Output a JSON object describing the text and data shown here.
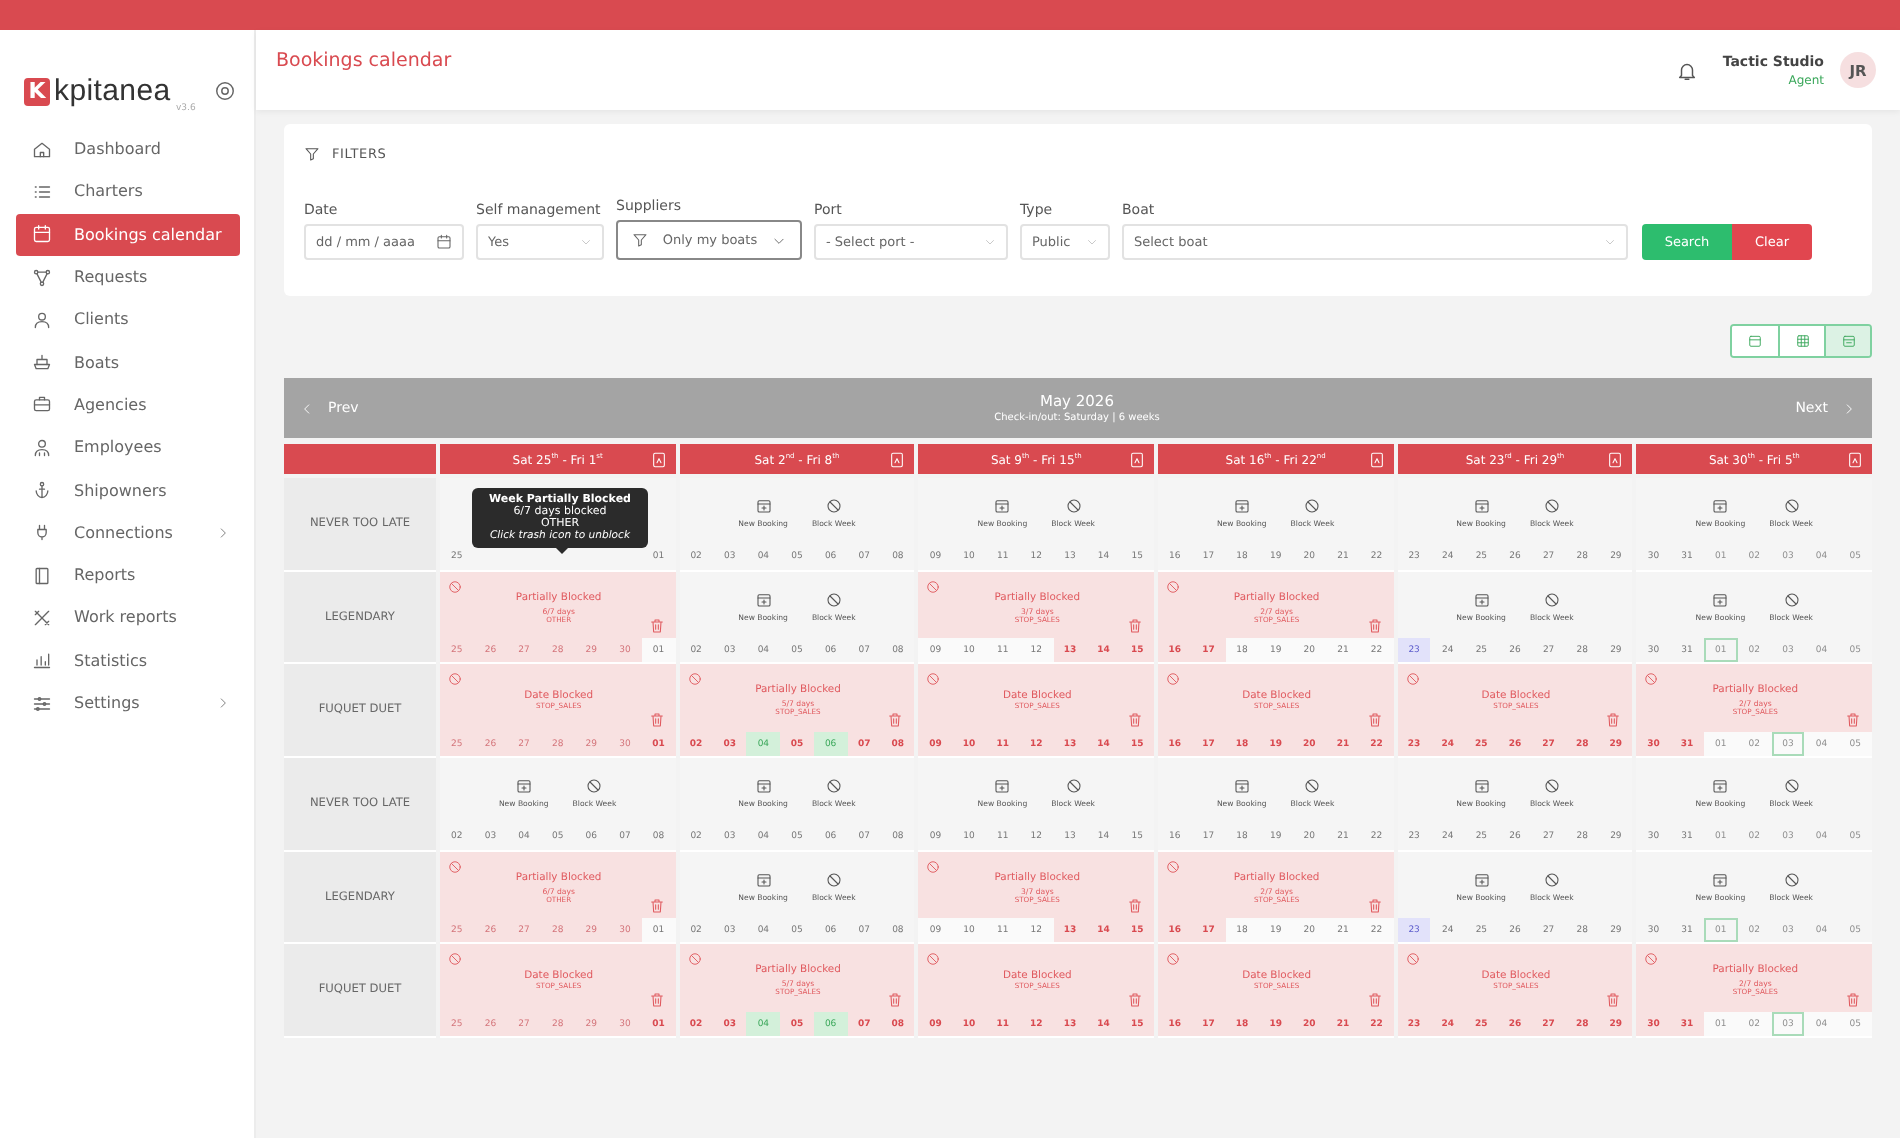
{
  "app": {
    "logo_letter": "K",
    "logo_text": "kpitanea",
    "version": "v3.6"
  },
  "sidebar": {
    "items": [
      {
        "label": "Dashboard",
        "selected": false,
        "submenu": false
      },
      {
        "label": "Charters",
        "selected": false,
        "submenu": false
      },
      {
        "label": "Bookings calendar",
        "selected": true,
        "submenu": false
      },
      {
        "label": "Requests",
        "selected": false,
        "submenu": false
      },
      {
        "label": "Clients",
        "selected": false,
        "submenu": false
      },
      {
        "label": "Boats",
        "selected": false,
        "submenu": false
      },
      {
        "label": "Agencies",
        "selected": false,
        "submenu": false
      },
      {
        "label": "Employees",
        "selected": false,
        "submenu": false
      },
      {
        "label": "Shipowners",
        "selected": false,
        "submenu": false
      },
      {
        "label": "Connections",
        "selected": false,
        "submenu": true
      },
      {
        "label": "Reports",
        "selected": false,
        "submenu": false
      },
      {
        "label": "Work reports",
        "selected": false,
        "submenu": false
      },
      {
        "label": "Statistics",
        "selected": false,
        "submenu": false
      },
      {
        "label": "Settings",
        "selected": false,
        "submenu": true
      }
    ]
  },
  "header": {
    "title": "Bookings calendar",
    "user_name": "Tactic Studio",
    "user_role": "Agent",
    "avatar": "JR"
  },
  "filters": {
    "title": "FILTERS",
    "fields": [
      {
        "label": "Date",
        "kind": "date",
        "placeholder": "dd / mm / aaaa"
      },
      {
        "label": "Self management",
        "kind": "select",
        "value": "Yes"
      },
      {
        "label": "Suppliers",
        "kind": "filter",
        "value": "Only my boats"
      },
      {
        "label": "Port",
        "kind": "select",
        "value": "- Select port -"
      },
      {
        "label": "Type",
        "kind": "select",
        "value": "Public"
      },
      {
        "label": "Boat",
        "kind": "select",
        "value": "Select boat"
      }
    ],
    "buttons": [
      {
        "label": "Search",
        "kind": "primary"
      },
      {
        "label": "Clear",
        "kind": "danger"
      }
    ]
  },
  "view_toggle": [
    {
      "selected": false
    },
    {
      "selected": false
    },
    {
      "selected": true
    }
  ],
  "calendar": {
    "prev": "Prev",
    "next": "Next",
    "month": "May 2026",
    "subtitle": "Check-in/out: Saturday | 6 weeks",
    "weeks": [
      {
        "label": "Sat 25$^{th}$ - Fri 1$^{st}$"
      },
      {
        "label": "Sat 2$^{nd}$ - Fri 8$^{th}$"
      },
      {
        "label": "Sat 9$^{th}$ - Fri 15$^{th}$"
      },
      {
        "label": "Sat 16$^{th}$ - Fri 22$^{nd}$"
      },
      {
        "label": "Sat 23$^{rd}$ - Fri 29$^{th}$"
      },
      {
        "label": "Sat 30$^{th}$ - Fri 5$^{th}$"
      }
    ],
    "rows": [
      {
        "boat": "NEVER TOO LATE",
        "cells": [
          {
            "kind": "free",
            "tooltip": {
              "title": "Week Partially Blocked",
              "lines": [
                "6/7 days blocked",
                "OTHER"
              ],
              "hint": "Click trash icon to unblock"
            },
            "days": [
              {
                "day": "25",
                "kind": "free"
              },
              {
                "day": "01",
                "kind": "free"
              }
            ]
          },
          {
            "kind": "free",
            "actions": [
              "New Booking",
              "Block Week"
            ],
            "days": [
              {
                "day": "02",
                "kind": "free"
              },
              {
                "day": "03",
                "kind": "free"
              },
              {
                "day": "04",
                "kind": "free"
              },
              {
                "day": "05",
                "kind": "free"
              },
              {
                "day": "06",
                "kind": "free"
              },
              {
                "day": "07",
                "kind": "free"
              },
              {
                "day": "08",
                "kind": "free"
              }
            ]
          },
          {
            "kind": "free",
            "actions": [
              "New Booking",
              "Block Week"
            ],
            "days": [
              {
                "day": "09",
                "kind": "free"
              },
              {
                "day": "10",
                "kind": "free"
              },
              {
                "day": "11",
                "kind": "free"
              },
              {
                "day": "12",
                "kind": "free"
              },
              {
                "day": "13",
                "kind": "free"
              },
              {
                "day": "14",
                "kind": "free"
              },
              {
                "day": "15",
                "kind": "free"
              }
            ]
          },
          {
            "kind": "free",
            "actions": [
              "New Booking",
              "Block Week"
            ],
            "days": [
              {
                "day": "16",
                "kind": "free"
              },
              {
                "day": "17",
                "kind": "free"
              },
              {
                "day": "18",
                "kind": "free"
              },
              {
                "day": "19",
                "kind": "free"
              },
              {
                "day": "20",
                "kind": "free"
              },
              {
                "day": "21",
                "kind": "free"
              },
              {
                "day": "22",
                "kind": "free"
              }
            ]
          },
          {
            "kind": "free",
            "actions": [
              "New Booking",
              "Block Week"
            ],
            "days": [
              {
                "day": "23",
                "kind": "free"
              },
              {
                "day": "24",
                "kind": "free"
              },
              {
                "day": "25",
                "kind": "free"
              },
              {
                "day": "26",
                "kind": "free"
              },
              {
                "day": "27",
                "kind": "free"
              },
              {
                "day": "28",
                "kind": "free"
              },
              {
                "day": "29",
                "kind": "free"
              }
            ]
          },
          {
            "kind": "free",
            "actions": [
              "New Booking",
              "Block Week"
            ],
            "days": [
              {
                "day": "30",
                "kind": "free"
              },
              {
                "day": "31",
                "kind": "free"
              },
              {
                "day": "01",
                "kind": "outside"
              },
              {
                "day": "02",
                "kind": "outside"
              },
              {
                "day": "03",
                "kind": "outside"
              },
              {
                "day": "04",
                "kind": "outside"
              },
              {
                "day": "05",
                "kind": "outside"
              }
            ]
          }
        ]
      },
      {
        "boat": "LEGENDARY",
        "cells": [
          {
            "kind": "blocked",
            "title": "Partially Blocked",
            "count": "6/7 days",
            "reason": "OTHER",
            "days": [
              {
                "day": "25",
                "kind": "faded"
              },
              {
                "day": "26",
                "kind": "faded"
              },
              {
                "day": "27",
                "kind": "faded"
              },
              {
                "day": "28",
                "kind": "faded"
              },
              {
                "day": "29",
                "kind": "faded"
              },
              {
                "day": "30",
                "kind": "faded"
              },
              {
                "day": "01",
                "kind": "free"
              }
            ]
          },
          {
            "kind": "free",
            "actions": [
              "New Booking",
              "Block Week"
            ],
            "days": [
              {
                "day": "02",
                "kind": "free"
              },
              {
                "day": "03",
                "kind": "free"
              },
              {
                "day": "04",
                "kind": "free"
              },
              {
                "day": "05",
                "kind": "free"
              },
              {
                "day": "06",
                "kind": "free"
              },
              {
                "day": "07",
                "kind": "free"
              },
              {
                "day": "08",
                "kind": "free"
              }
            ]
          },
          {
            "kind": "blocked",
            "title": "Partially Blocked",
            "count": "3/7 days",
            "reason": "STOP_SALES",
            "days": [
              {
                "day": "09",
                "kind": "free"
              },
              {
                "day": "10",
                "kind": "free"
              },
              {
                "day": "11",
                "kind": "free"
              },
              {
                "day": "12",
                "kind": "free"
              },
              {
                "day": "13",
                "kind": "blocked"
              },
              {
                "day": "14",
                "kind": "blocked"
              },
              {
                "day": "15",
                "kind": "blocked"
              }
            ]
          },
          {
            "kind": "blocked",
            "title": "Partially Blocked",
            "count": "2/7 days",
            "reason": "STOP_SALES",
            "days": [
              {
                "day": "16",
                "kind": "blocked"
              },
              {
                "day": "17",
                "kind": "blocked"
              },
              {
                "day": "18",
                "kind": "free"
              },
              {
                "day": "19",
                "kind": "free"
              },
              {
                "day": "20",
                "kind": "free"
              },
              {
                "day": "21",
                "kind": "free"
              },
              {
                "day": "22",
                "kind": "free"
              }
            ]
          },
          {
            "kind": "free",
            "actions": [
              "New Booking",
              "Block Week"
            ],
            "days": [
              {
                "day": "23",
                "kind": "today"
              },
              {
                "day": "24",
                "kind": "free"
              },
              {
                "day": "25",
                "kind": "free"
              },
              {
                "day": "26",
                "kind": "free"
              },
              {
                "day": "27",
                "kind": "free"
              },
              {
                "day": "28",
                "kind": "free"
              },
              {
                "day": "29",
                "kind": "free"
              }
            ]
          },
          {
            "kind": "free",
            "actions": [
              "New Booking",
              "Block Week"
            ],
            "days": [
              {
                "day": "30",
                "kind": "free"
              },
              {
                "day": "31",
                "kind": "free"
              },
              {
                "day": "01",
                "kind": "outside-marked"
              },
              {
                "day": "02",
                "kind": "outside"
              },
              {
                "day": "03",
                "kind": "outside"
              },
              {
                "day": "04",
                "kind": "outside"
              },
              {
                "day": "05",
                "kind": "outside"
              }
            ]
          }
        ]
      },
      {
        "boat": "FUQUET DUET",
        "cells": [
          {
            "kind": "blocked",
            "title": "Date Blocked",
            "reason": "STOP_SALES",
            "days": [
              {
                "day": "25",
                "kind": "faded"
              },
              {
                "day": "26",
                "kind": "faded"
              },
              {
                "day": "27",
                "kind": "faded"
              },
              {
                "day": "28",
                "kind": "faded"
              },
              {
                "day": "29",
                "kind": "faded"
              },
              {
                "day": "30",
                "kind": "faded"
              },
              {
                "day": "01",
                "kind": "blocked"
              }
            ]
          },
          {
            "kind": "blocked",
            "title": "Partially Blocked",
            "count": "5/7 days",
            "reason": "STOP_SALES",
            "days": [
              {
                "day": "02",
                "kind": "blocked"
              },
              {
                "day": "03",
                "kind": "blocked"
              },
              {
                "day": "04",
                "kind": "booked"
              },
              {
                "day": "05",
                "kind": "blocked"
              },
              {
                "day": "06",
                "kind": "booked"
              },
              {
                "day": "07",
                "kind": "blocked"
              },
              {
                "day": "08",
                "kind": "blocked"
              }
            ]
          },
          {
            "kind": "blocked",
            "title": "Date Blocked",
            "reason": "STOP_SALES",
            "days": [
              {
                "day": "09",
                "kind": "blocked"
              },
              {
                "day": "10",
                "kind": "blocked"
              },
              {
                "day": "11",
                "kind": "blocked"
              },
              {
                "day": "12",
                "kind": "blocked"
              },
              {
                "day": "13",
                "kind": "blocked"
              },
              {
                "day": "14",
                "kind": "blocked"
              },
              {
                "day": "15",
                "kind": "blocked"
              }
            ]
          },
          {
            "kind": "blocked",
            "title": "Date Blocked",
            "reason": "STOP_SALES",
            "days": [
              {
                "day": "16",
                "kind": "blocked"
              },
              {
                "day": "17",
                "kind": "blocked"
              },
              {
                "day": "18",
                "kind": "blocked"
              },
              {
                "day": "19",
                "kind": "blocked"
              },
              {
                "day": "20",
                "kind": "blocked"
              },
              {
                "day": "21",
                "kind": "blocked"
              },
              {
                "day": "22",
                "kind": "blocked"
              }
            ]
          },
          {
            "kind": "blocked",
            "title": "Date Blocked",
            "reason": "STOP_SALES",
            "days": [
              {
                "day": "23",
                "kind": "blocked"
              },
              {
                "day": "24",
                "kind": "blocked"
              },
              {
                "day": "25",
                "kind": "blocked"
              },
              {
                "day": "26",
                "kind": "blocked"
              },
              {
                "day": "27",
                "kind": "blocked"
              },
              {
                "day": "28",
                "kind": "blocked"
              },
              {
                "day": "29",
                "kind": "blocked"
              }
            ]
          },
          {
            "kind": "blocked",
            "title": "Partially Blocked",
            "count": "2/7 days",
            "reason": "STOP_SALES",
            "days": [
              {
                "day": "30",
                "kind": "blocked"
              },
              {
                "day": "31",
                "kind": "blocked"
              },
              {
                "day": "01",
                "kind": "outside"
              },
              {
                "day": "02",
                "kind": "outside"
              },
              {
                "day": "03",
                "kind": "outside-marked"
              },
              {
                "day": "04",
                "kind": "outside"
              },
              {
                "day": "05",
                "kind": "outside"
              }
            ]
          }
        ]
      },
      {
        "boat": "NEVER TOO LATE",
        "cells": [
          {
            "kind": "free",
            "actions": [
              "New Booking",
              "Block Week"
            ],
            "days": [
              {
                "day": "02",
                "kind": "free"
              },
              {
                "day": "03",
                "kind": "free"
              },
              {
                "day": "04",
                "kind": "free"
              },
              {
                "day": "05",
                "kind": "free"
              },
              {
                "day": "06",
                "kind": "free"
              },
              {
                "day": "07",
                "kind": "free"
              },
              {
                "day": "08",
                "kind": "free"
              }
            ]
          },
          {
            "kind": "free",
            "actions": [
              "New Booking",
              "Block Week"
            ],
            "days": [
              {
                "day": "02",
                "kind": "free"
              },
              {
                "day": "03",
                "kind": "free"
              },
              {
                "day": "04",
                "kind": "free"
              },
              {
                "day": "05",
                "kind": "free"
              },
              {
                "day": "06",
                "kind": "free"
              },
              {
                "day": "07",
                "kind": "free"
              },
              {
                "day": "08",
                "kind": "free"
              }
            ]
          },
          {
            "kind": "free",
            "actions": [
              "New Booking",
              "Block Week"
            ],
            "days": [
              {
                "day": "09",
                "kind": "free"
              },
              {
                "day": "10",
                "kind": "free"
              },
              {
                "day": "11",
                "kind": "free"
              },
              {
                "day": "12",
                "kind": "free"
              },
              {
                "day": "13",
                "kind": "free"
              },
              {
                "day": "14",
                "kind": "free"
              },
              {
                "day": "15",
                "kind": "free"
              }
            ]
          },
          {
            "kind": "free",
            "actions": [
              "New Booking",
              "Block Week"
            ],
            "days": [
              {
                "day": "16",
                "kind": "free"
              },
              {
                "day": "17",
                "kind": "free"
              },
              {
                "day": "18",
                "kind": "free"
              },
              {
                "day": "19",
                "kind": "free"
              },
              {
                "day": "20",
                "kind": "free"
              },
              {
                "day": "21",
                "kind": "free"
              },
              {
                "day": "22",
                "kind": "free"
              }
            ]
          },
          {
            "kind": "free",
            "actions": [
              "New Booking",
              "Block Week"
            ],
            "days": [
              {
                "day": "23",
                "kind": "free"
              },
              {
                "day": "24",
                "kind": "free"
              },
              {
                "day": "25",
                "kind": "free"
              },
              {
                "day": "26",
                "kind": "free"
              },
              {
                "day": "27",
                "kind": "free"
              },
              {
                "day": "28",
                "kind": "free"
              },
              {
                "day": "29",
                "kind": "free"
              }
            ]
          },
          {
            "kind": "free",
            "actions": [
              "New Booking",
              "Block Week"
            ],
            "days": [
              {
                "day": "30",
                "kind": "free"
              },
              {
                "day": "31",
                "kind": "free"
              },
              {
                "day": "01",
                "kind": "outside"
              },
              {
                "day": "02",
                "kind": "outside"
              },
              {
                "day": "03",
                "kind": "outside"
              },
              {
                "day": "04",
                "kind": "outside"
              },
              {
                "day": "05",
                "kind": "outside"
              }
            ]
          }
        ]
      },
      {
        "boat": "LEGENDARY",
        "cells": [
          {
            "kind": "blocked",
            "title": "Partially Blocked",
            "count": "6/7 days",
            "reason": "OTHER",
            "days": [
              {
                "day": "25",
                "kind": "faded"
              },
              {
                "day": "26",
                "kind": "faded"
              },
              {
                "day": "27",
                "kind": "faded"
              },
              {
                "day": "28",
                "kind": "faded"
              },
              {
                "day": "29",
                "kind": "faded"
              },
              {
                "day": "30",
                "kind": "faded"
              },
              {
                "day": "01",
                "kind": "free"
              }
            ]
          },
          {
            "kind": "free",
            "actions": [
              "New Booking",
              "Block Week"
            ],
            "days": [
              {
                "day": "02",
                "kind": "free"
              },
              {
                "day": "03",
                "kind": "free"
              },
              {
                "day": "04",
                "kind": "free"
              },
              {
                "day": "05",
                "kind": "free"
              },
              {
                "day": "06",
                "kind": "free"
              },
              {
                "day": "07",
                "kind": "free"
              },
              {
                "day": "08",
                "kind": "free"
              }
            ]
          },
          {
            "kind": "blocked",
            "title": "Partially Blocked",
            "count": "3/7 days",
            "reason": "STOP_SALES",
            "days": [
              {
                "day": "09",
                "kind": "free"
              },
              {
                "day": "10",
                "kind": "free"
              },
              {
                "day": "11",
                "kind": "free"
              },
              {
                "day": "12",
                "kind": "free"
              },
              {
                "day": "13",
                "kind": "blocked"
              },
              {
                "day": "14",
                "kind": "blocked"
              },
              {
                "day": "15",
                "kind": "blocked"
              }
            ]
          },
          {
            "kind": "blocked",
            "title": "Partially Blocked",
            "count": "2/7 days",
            "reason": "STOP_SALES",
            "days": [
              {
                "day": "16",
                "kind": "blocked"
              },
              {
                "day": "17",
                "kind": "blocked"
              },
              {
                "day": "18",
                "kind": "free"
              },
              {
                "day": "19",
                "kind": "free"
              },
              {
                "day": "20",
                "kind": "free"
              },
              {
                "day": "21",
                "kind": "free"
              },
              {
                "day": "22",
                "kind": "free"
              }
            ]
          },
          {
            "kind": "free",
            "actions": [
              "New Booking",
              "Block Week"
            ],
            "days": [
              {
                "day": "23",
                "kind": "today"
              },
              {
                "day": "24",
                "kind": "free"
              },
              {
                "day": "25",
                "kind": "free"
              },
              {
                "day": "26",
                "kind": "free"
              },
              {
                "day": "27",
                "kind": "free"
              },
              {
                "day": "28",
                "kind": "free"
              },
              {
                "day": "29",
                "kind": "free"
              }
            ]
          },
          {
            "kind": "free",
            "actions": [
              "New Booking",
              "Block Week"
            ],
            "days": [
              {
                "day": "30",
                "kind": "free"
              },
              {
                "day": "31",
                "kind": "free"
              },
              {
                "day": "01",
                "kind": "outside-marked"
              },
              {
                "day": "02",
                "kind": "outside"
              },
              {
                "day": "03",
                "kind": "outside"
              },
              {
                "day": "04",
                "kind": "outside"
              },
              {
                "day": "05",
                "kind": "outside"
              }
            ]
          }
        ]
      },
      {
        "boat": "FUQUET DUET",
        "cells": [
          {
            "kind": "blocked",
            "title": "Date Blocked",
            "reason": "STOP_SALES",
            "days": [
              {
                "day": "25",
                "kind": "faded"
              },
              {
                "day": "26",
                "kind": "faded"
              },
              {
                "day": "27",
                "kind": "faded"
              },
              {
                "day": "28",
                "kind": "faded"
              },
              {
                "day": "29",
                "kind": "faded"
              },
              {
                "day": "30",
                "kind": "faded"
              },
              {
                "day": "01",
                "kind": "blocked"
              }
            ]
          },
          {
            "kind": "blocked",
            "title": "Partially Blocked",
            "count": "5/7 days",
            "reason": "STOP_SALES",
            "days": [
              {
                "day": "02",
                "kind": "blocked"
              },
              {
                "day": "03",
                "kind": "blocked"
              },
              {
                "day": "04",
                "kind": "booked"
              },
              {
                "day": "05",
                "kind": "blocked"
              },
              {
                "day": "06",
                "kind": "booked"
              },
              {
                "day": "07",
                "kind": "blocked"
              },
              {
                "day": "08",
                "kind": "blocked"
              }
            ]
          },
          {
            "kind": "blocked",
            "title": "Date Blocked",
            "reason": "STOP_SALES",
            "days": [
              {
                "day": "09",
                "kind": "blocked"
              },
              {
                "day": "10",
                "kind": "blocked"
              },
              {
                "day": "11",
                "kind": "blocked"
              },
              {
                "day": "12",
                "kind": "blocked"
              },
              {
                "day": "13",
                "kind": "blocked"
              },
              {
                "day": "14",
                "kind": "blocked"
              },
              {
                "day": "15",
                "kind": "blocked"
              }
            ]
          },
          {
            "kind": "blocked",
            "title": "Date Blocked",
            "reason": "STOP_SALES",
            "days": [
              {
                "day": "16",
                "kind": "blocked"
              },
              {
                "day": "17",
                "kind": "blocked"
              },
              {
                "day": "18",
                "kind": "blocked"
              },
              {
                "day": "19",
                "kind": "blocked"
              },
              {
                "day": "20",
                "kind": "blocked"
              },
              {
                "day": "21",
                "kind": "blocked"
              },
              {
                "day": "22",
                "kind": "blocked"
              }
            ]
          },
          {
            "kind": "blocked",
            "title": "Date Blocked",
            "reason": "STOP_SALES",
            "days": [
              {
                "day": "23",
                "kind": "blocked"
              },
              {
                "day": "24",
                "kind": "blocked"
              },
              {
                "day": "25",
                "kind": "blocked"
              },
              {
                "day": "26",
                "kind": "blocked"
              },
              {
                "day": "27",
                "kind": "blocked"
              },
              {
                "day": "28",
                "kind": "blocked"
              },
              {
                "day": "29",
                "kind": "blocked"
              }
            ]
          },
          {
            "kind": "blocked",
            "title": "Partially Blocked",
            "count": "2/7 days",
            "reason": "STOP_SALES",
            "days": [
              {
                "day": "30",
                "kind": "blocked"
              },
              {
                "day": "31",
                "kind": "blocked"
              },
              {
                "day": "01",
                "kind": "outside"
              },
              {
                "day": "02",
                "kind": "outside"
              },
              {
                "day": "03",
                "kind": "outside-marked"
              },
              {
                "day": "04",
                "kind": "outside"
              },
              {
                "day": "05",
                "kind": "outside"
              }
            ]
          }
        ]
      }
    ]
  }
}
